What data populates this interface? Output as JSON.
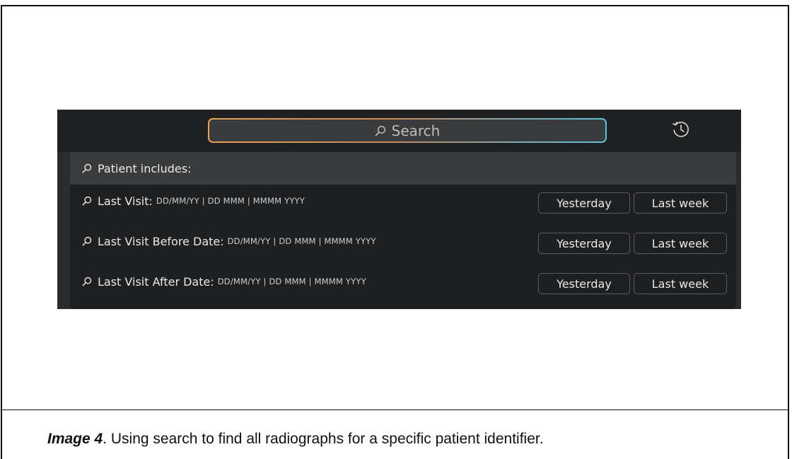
{
  "search": {
    "placeholder": "Search"
  },
  "dropdown": {
    "header": "Patient includes:",
    "rows": [
      {
        "label": "Last Visit:",
        "format": "DD/MM/YY | DD MMM | MMMM YYYY",
        "chip1": "Yesterday",
        "chip2": "Last week"
      },
      {
        "label": "Last Visit Before Date:",
        "format": "DD/MM/YY | DD MMM | MMMM YYYY",
        "chip1": "Yesterday",
        "chip2": "Last week"
      },
      {
        "label": "Last Visit After Date:",
        "format": "DD/MM/YY | DD MMM | MMMM YYYY",
        "chip1": "Yesterday",
        "chip2": "Last week"
      }
    ]
  },
  "caption": {
    "prefix": "Image 4",
    "text": ". Using search to find all radiographs for a specific patient identifier."
  },
  "colors": {
    "search_border_start": "#e8a15a",
    "search_border_end": "#5fc3d4",
    "panel_bg": "#1e1f21",
    "topbar_bg": "#1f2022"
  },
  "icons": [
    "search-icon",
    "history-icon"
  ]
}
